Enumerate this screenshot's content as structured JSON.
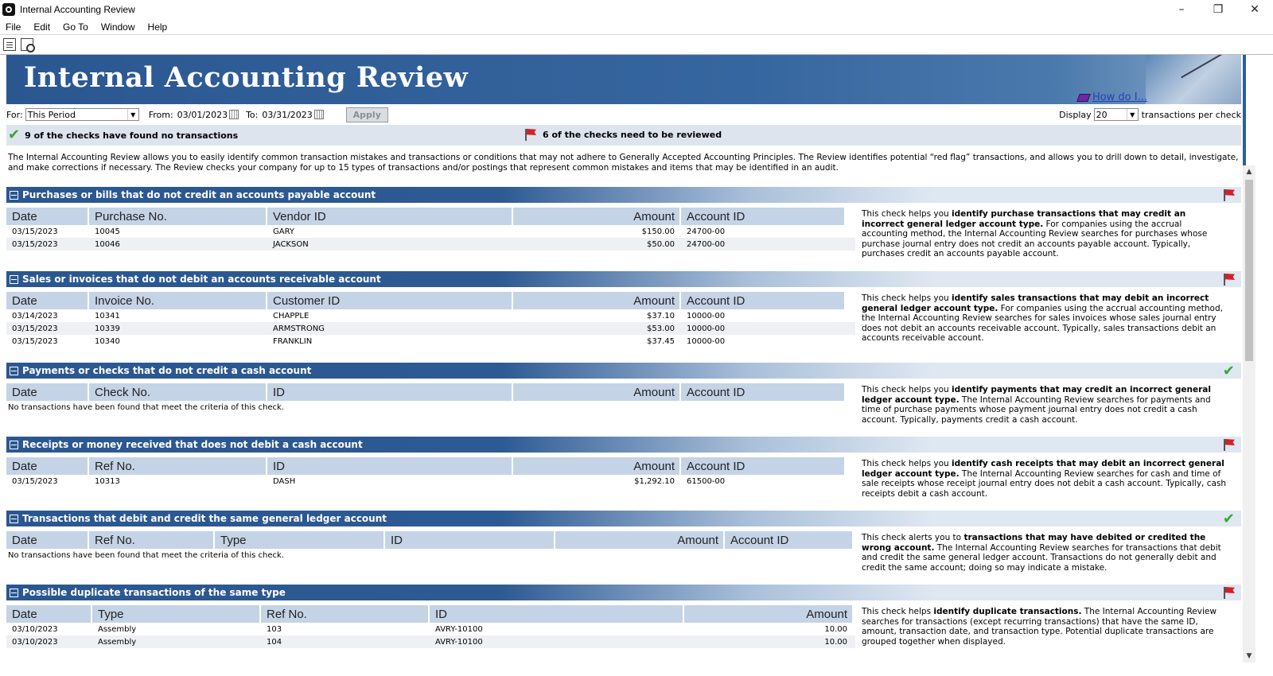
{
  "window": {
    "title": "Internal Accounting Review"
  },
  "menu": [
    "File",
    "Edit",
    "Go To",
    "Window",
    "Help"
  ],
  "banner": {
    "title": "Internal Accounting Review",
    "howdo": "How do I..."
  },
  "filters": {
    "for_label": "For:",
    "for_value": "This Period",
    "from_label": "From:",
    "from_value": "03/01/2023",
    "to_label": "To:",
    "to_value": "03/31/2023",
    "apply_label": "Apply",
    "display_label": "Display",
    "display_value": "20",
    "per_label": "transactions per check"
  },
  "status": {
    "ok_text": "9 of the checks have found no transactions",
    "flag_text": "6 of the checks need to be reviewed"
  },
  "intro": "The Internal Accounting Review allows you to easily identify common transaction mistakes and transactions or conditions that may not adhere to Generally Accepted Accounting Principles. The Review identifies potential “red flag” transactions, and allows you to drill down to detail, investigate, and make corrections if necessary. The Review checks your company for up to 15 types of transactions and/or postings that represent common mistakes and items that may be identified in an audit.",
  "sections": [
    {
      "title": "Purchases or bills that do not credit an accounts payable account",
      "status": "flag",
      "columns": [
        "Date",
        "Purchase No.",
        "Vendor ID",
        "Amount",
        "Account ID"
      ],
      "rows": [
        [
          "03/15/2023",
          "10045",
          "GARY",
          "$150.00",
          "24700-00"
        ],
        [
          "03/15/2023",
          "10046",
          "JACKSON",
          "$50.00",
          "24700-00"
        ]
      ],
      "none": "",
      "desc_pre": "This check helps you ",
      "desc_bold": "identify purchase transactions that may credit an incorrect general ledger account type.",
      "desc_post": " For companies using the accrual accounting method, the Internal Accounting Review searches for purchases whose purchase journal entry does not credit an accounts payable account. Typically, purchases credit an accounts payable account."
    },
    {
      "title": "Sales or invoices that do not debit an accounts receivable account",
      "status": "flag",
      "columns": [
        "Date",
        "Invoice No.",
        "Customer ID",
        "Amount",
        "Account ID"
      ],
      "rows": [
        [
          "03/14/2023",
          "10341",
          "CHAPPLE",
          "$37.10",
          "10000-00"
        ],
        [
          "03/15/2023",
          "10339",
          "ARMSTRONG",
          "$53.00",
          "10000-00"
        ],
        [
          "03/15/2023",
          "10340",
          "FRANKLIN",
          "$37.45",
          "10000-00"
        ]
      ],
      "none": "",
      "desc_pre": "This check helps you ",
      "desc_bold": "identify sales transactions that may debit an incorrect general ledger account type.",
      "desc_post": " For companies using the accrual accounting method, the Internal Accounting Review searches for sales invoices whose sales journal entry does not debit an accounts receivable account. Typically, sales transactions debit an accounts receivable account."
    },
    {
      "title": "Payments or checks that do not credit a cash account",
      "status": "ok",
      "columns": [
        "Date",
        "Check No.",
        "ID",
        "Amount",
        "Account ID"
      ],
      "rows": [],
      "none": "No transactions have been found that meet the criteria of this check.",
      "desc_pre": "This check helps you ",
      "desc_bold": "identify payments that may credit an incorrect general ledger account type.",
      "desc_post": " The Internal Accounting Review searches for payments and time of purchase payments whose payment journal entry does not credit a cash account. Typically, payments credit a cash account."
    },
    {
      "title": "Receipts or money received that does not debit a cash account",
      "status": "flag",
      "columns": [
        "Date",
        "Ref No.",
        "ID",
        "Amount",
        "Account ID"
      ],
      "rows": [
        [
          "03/15/2023",
          "10313",
          "DASH",
          "$1,292.10",
          "61500-00"
        ]
      ],
      "none": "",
      "desc_pre": "This check helps you ",
      "desc_bold": "identify cash receipts that may debit an incorrect general ledger account type.",
      "desc_post": " The Internal Accounting Review searches for cash and time of sale receipts whose receipt journal entry does not debit a cash account. Typically, cash receipts debit a cash account."
    },
    {
      "title": "Transactions that debit and credit the same general ledger account",
      "status": "ok",
      "columns": [
        "Date",
        "Ref No.",
        "Type",
        "ID",
        "Amount",
        "Account ID"
      ],
      "rows": [],
      "none": "No transactions have been found that meet the criteria of this check.",
      "desc_pre": "This check alerts you to ",
      "desc_bold": "transactions that may have debited or credited the wrong account.",
      "desc_post": " The Internal Accounting Review searches for transactions that debit and credit the same general ledger account. Transactions do not generally debit and credit the same account; doing so may indicate a mistake."
    },
    {
      "title": "Possible duplicate transactions of the same type",
      "status": "flag",
      "columns": [
        "Date",
        "Type",
        "Ref No.",
        "ID",
        "Amount"
      ],
      "rows": [
        [
          "03/10/2023",
          "Assembly",
          "103",
          "AVRY-10100",
          "10.00"
        ],
        [
          "03/10/2023",
          "Assembly",
          "104",
          "AVRY-10100",
          "10.00"
        ]
      ],
      "none": "",
      "desc_pre": "This check helps ",
      "desc_bold": "identify duplicate transactions.",
      "desc_post": " The Internal Accounting Review searches for transactions (except recurring transactions) that have the same ID, amount, transaction date, and transaction type. Potential duplicate transactions are grouped together when displayed."
    }
  ]
}
